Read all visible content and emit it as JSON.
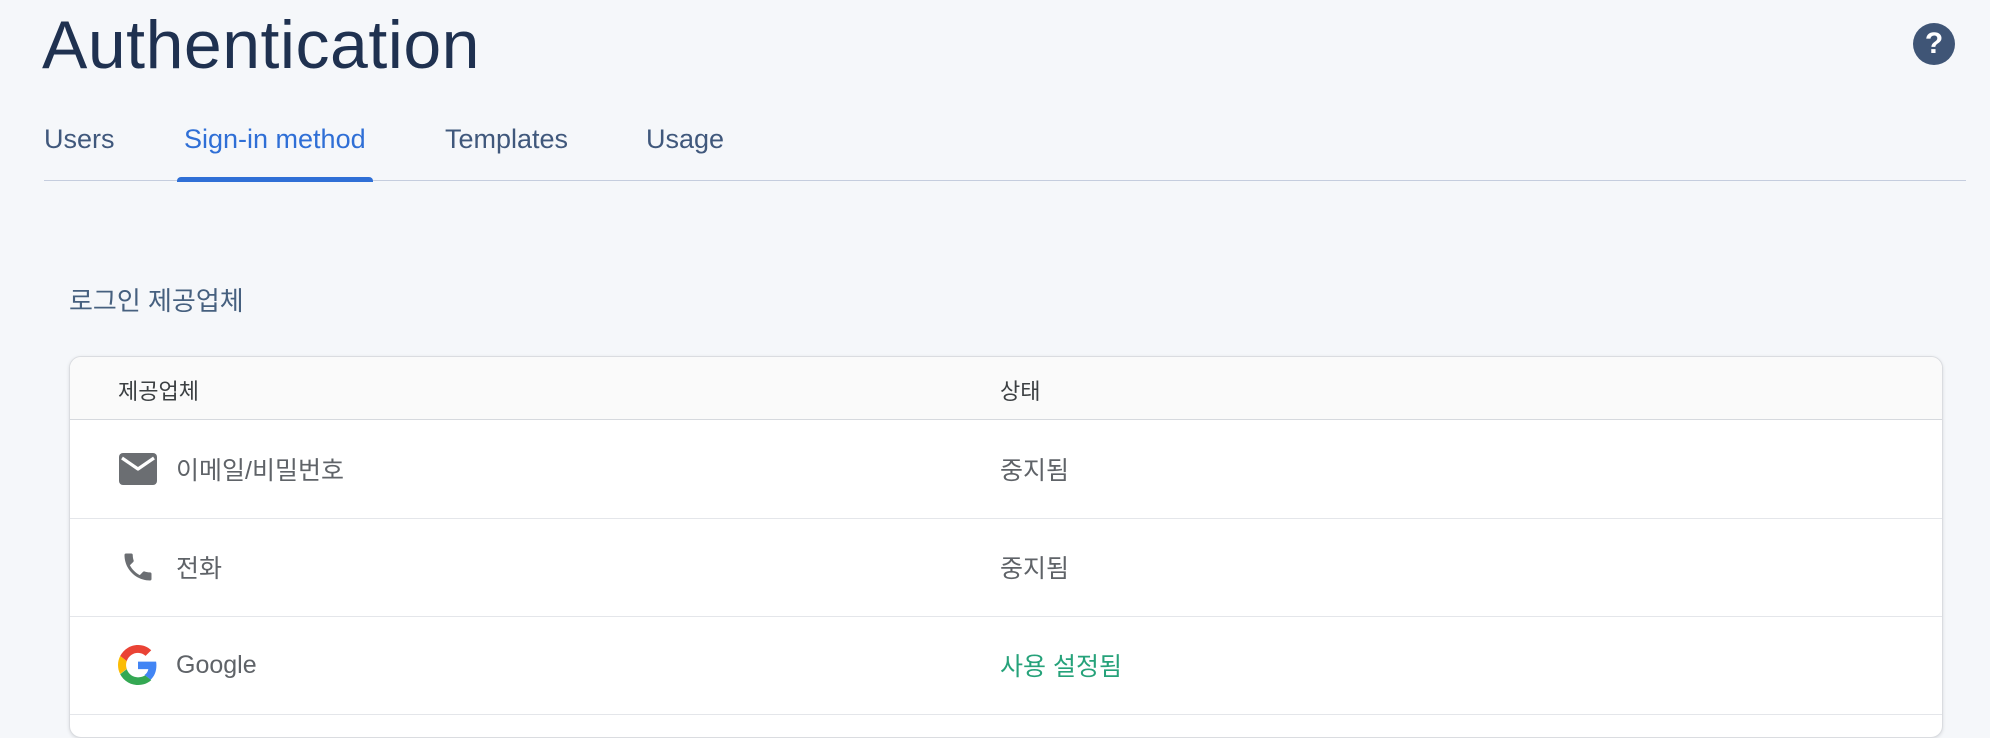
{
  "header": {
    "title": "Authentication",
    "help_icon": "help-circle-icon"
  },
  "tabs": [
    {
      "label": "Users",
      "active": false
    },
    {
      "label": "Sign-in method",
      "active": true
    },
    {
      "label": "Templates",
      "active": false
    },
    {
      "label": "Usage",
      "active": false
    }
  ],
  "section": {
    "title": "로그인 제공업체"
  },
  "table": {
    "columns": {
      "provider": "제공업체",
      "status": "상태"
    },
    "rows": [
      {
        "provider": "이메일/비밀번호",
        "status": "중지됨",
        "icon": "email-icon",
        "enabled": false
      },
      {
        "provider": "전화",
        "status": "중지됨",
        "icon": "phone-icon",
        "enabled": false
      },
      {
        "provider": "Google",
        "status": "사용 설정됨",
        "icon": "google-icon",
        "enabled": true
      }
    ]
  },
  "colors": {
    "accent": "#2f6fd6",
    "enabled_status": "#26a27a",
    "title": "#1f3150"
  }
}
